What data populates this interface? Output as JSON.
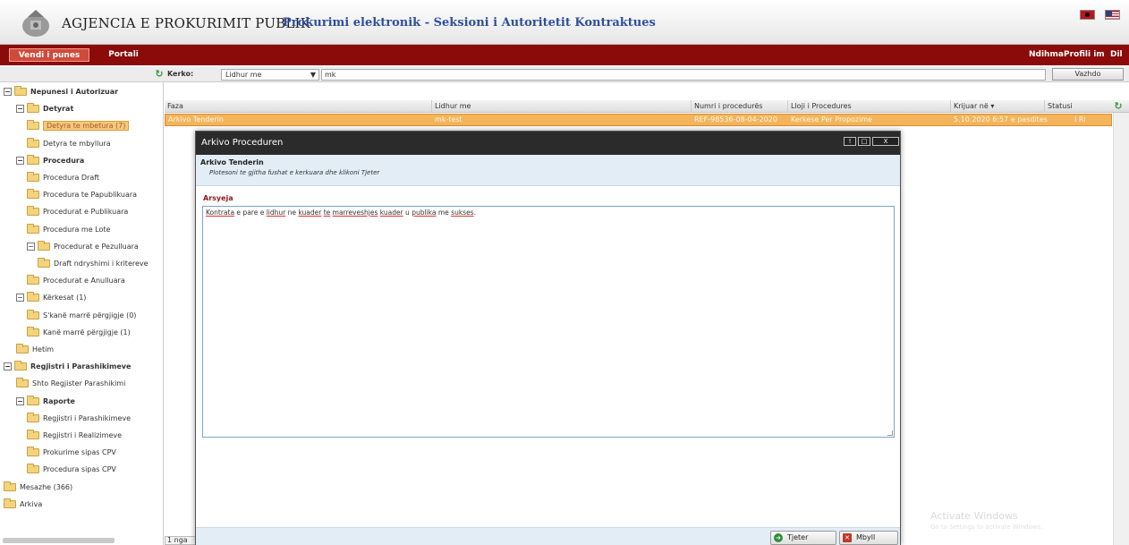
{
  "header": {
    "agency": "AGJENCIA E PROKURIMIT PUBLIK",
    "subtitle": "Prokurimi elektronik - Seksioni i Autoritetit Kontraktues"
  },
  "nav": {
    "tabs": [
      "Vendi i punes",
      "Portali"
    ],
    "right": [
      "Ndihma",
      "Profili im",
      "Dil"
    ]
  },
  "search": {
    "label": "Kerko:",
    "select_value": "Lidhur me",
    "input_value": "mk",
    "button": "Vazhdo"
  },
  "sidebar": {
    "items": [
      {
        "label": "Nepunesi i Autorizuar",
        "level": 0,
        "toggle": "−",
        "bold": true
      },
      {
        "label": "Detyrat",
        "level": 1,
        "toggle": "−",
        "bold": true
      },
      {
        "label": "Detyra te mbetura (7)",
        "level": 2,
        "selected": true
      },
      {
        "label": "Detyra te mbyllura",
        "level": 2
      },
      {
        "label": "Procedura",
        "level": 1,
        "toggle": "−",
        "bold": true
      },
      {
        "label": "Procedura Draft",
        "level": 2
      },
      {
        "label": "Procedura te Papublikuara",
        "level": 2
      },
      {
        "label": "Procedurat e Publikuara",
        "level": 2
      },
      {
        "label": "Procedura me Lote",
        "level": 2
      },
      {
        "label": "Procedurat e Pezulluara",
        "level": 2,
        "toggle": "−"
      },
      {
        "label": "Draft ndryshimi i kritereve",
        "level": 3
      },
      {
        "label": "Procedurat e Anulluara",
        "level": 2
      },
      {
        "label": "Kërkesat (1)",
        "level": 1,
        "toggle": "−"
      },
      {
        "label": "S'kanë marrë përgjigje (0)",
        "level": 2
      },
      {
        "label": "Kanë marrë përgjigje (1)",
        "level": 2
      },
      {
        "label": "Hetim",
        "level": 1
      },
      {
        "label": "Regjistri i Parashikimeve",
        "level": 0,
        "toggle": "−",
        "bold": true
      },
      {
        "label": "Shto Regjister Parashikimi",
        "level": 1
      },
      {
        "label": "Raporte",
        "level": 1,
        "toggle": "−",
        "bold": true
      },
      {
        "label": "Regjistri i Parashikimeve",
        "level": 2
      },
      {
        "label": "Regjistri i Realizimeve",
        "level": 2
      },
      {
        "label": "Prokurime sipas CPV",
        "level": 2
      },
      {
        "label": "Procedura sipas CPV",
        "level": 2
      },
      {
        "label": "Mesazhe (366)",
        "level": 0
      },
      {
        "label": "Arkiva",
        "level": 0
      }
    ]
  },
  "grid": {
    "columns": [
      "Faza",
      "Lidhur me",
      "Numri i procedurës",
      "Lloji i Procedures",
      "Krijuar në ▾",
      "Statusi"
    ],
    "row": [
      "Arkivo Tenderin",
      "mk-test",
      "REF-98536-08-04-2020",
      "Kerkese Per Propozime",
      "5.10.2020 6:57 e pasdites",
      "I Ri"
    ],
    "footer": "1 nga"
  },
  "modal": {
    "title": "Arkivo Proceduren",
    "win_buttons": [
      "!",
      "□",
      "X"
    ],
    "section_title": "Arkivo Tenderin",
    "section_desc": "Plotesoni te gjitha fushat e kerkuara dhe klikoni Tjeter",
    "field_label": "Arsyeja",
    "text_segments": [
      {
        "t": "Kontrata",
        "u": true
      },
      {
        "t": " e pare e ",
        "u": false
      },
      {
        "t": "lidhur",
        "u": true
      },
      {
        "t": " ne ",
        "u": false
      },
      {
        "t": "kuader",
        "u": true
      },
      {
        "t": " ",
        "u": false
      },
      {
        "t": "te",
        "u": true
      },
      {
        "t": " ",
        "u": false
      },
      {
        "t": "marreveshjes",
        "u": true
      },
      {
        "t": " ",
        "u": false
      },
      {
        "t": "kuader",
        "u": true
      },
      {
        "t": " u ",
        "u": false
      },
      {
        "t": "publika",
        "u": true
      },
      {
        "t": " me ",
        "u": false
      },
      {
        "t": "sukses",
        "u": true
      },
      {
        "t": ".",
        "u": false
      }
    ],
    "buttons": {
      "next": "Tjeter",
      "close": "Mbyll"
    }
  },
  "watermark": {
    "line1": "Activate Windows",
    "line2": "Go to Settings to activate Windows."
  },
  "colors": {
    "nav_red": "#8b0a0a",
    "selected_row": "#f3b45c",
    "modal_title": "#2b2b2b",
    "label_red": "#8a1a1a"
  }
}
